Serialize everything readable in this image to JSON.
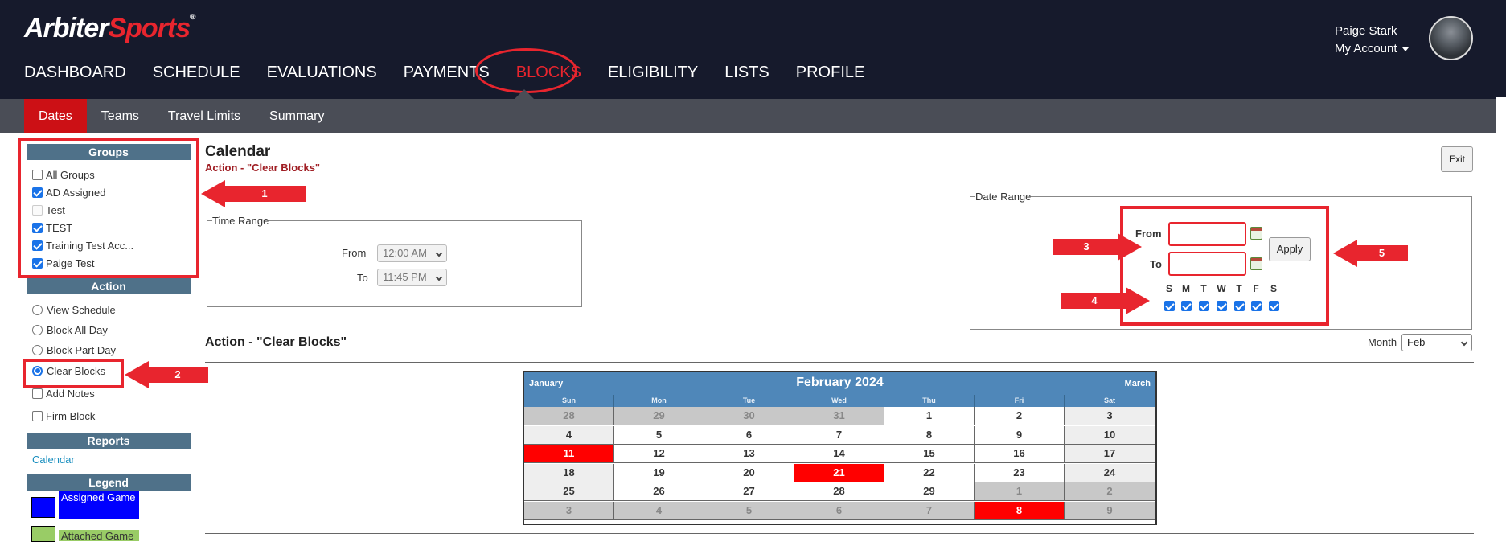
{
  "header": {
    "logo_part1": "Arbiter",
    "logo_part2": "Sports",
    "logo_tm": "®",
    "nav": [
      "DASHBOARD",
      "SCHEDULE",
      "EVALUATIONS",
      "PAYMENTS",
      "BLOCKS",
      "ELIGIBILITY",
      "LISTS",
      "PROFILE"
    ],
    "active_nav": "BLOCKS",
    "user_name": "Paige Stark",
    "account_label": "My Account"
  },
  "subnav": {
    "tabs": [
      "Dates",
      "Teams",
      "Travel Limits",
      "Summary"
    ],
    "active": "Dates"
  },
  "sidebar": {
    "groups_header": "Groups",
    "groups": [
      {
        "label": "All Groups",
        "checked": false,
        "disabled": false
      },
      {
        "label": "AD Assigned",
        "checked": true,
        "disabled": false
      },
      {
        "label": "Test",
        "checked": false,
        "disabled": true
      },
      {
        "label": "TEST",
        "checked": true,
        "disabled": false
      },
      {
        "label": "Training Test Acc...",
        "checked": true,
        "disabled": false
      },
      {
        "label": "Paige Test",
        "checked": true,
        "disabled": false
      }
    ],
    "action_header": "Action",
    "actions": [
      {
        "label": "View Schedule",
        "type": "radio",
        "checked": false
      },
      {
        "label": "Block All Day",
        "type": "radio",
        "checked": false
      },
      {
        "label": "Block Part Day",
        "type": "radio",
        "checked": false
      },
      {
        "label": "Clear Blocks",
        "type": "radio",
        "checked": true
      },
      {
        "label": "Add Notes",
        "type": "checkbox",
        "checked": false
      },
      {
        "label": "Firm Block",
        "type": "checkbox",
        "checked": false
      }
    ],
    "reports_header": "Reports",
    "reports_link": "Calendar",
    "legend_header": "Legend",
    "legend": [
      {
        "label": "Assigned Game",
        "color": "#0000ff",
        "label_bg": "#0000ff"
      },
      {
        "label": "Attached Game",
        "color": "#99cc66",
        "label_bg": "#99cc66"
      }
    ]
  },
  "main": {
    "title": "Calendar",
    "action_subtitle": "Action - \"Clear Blocks\"",
    "exit_label": "Exit",
    "time_range": {
      "legend": "Time Range",
      "from_label": "From",
      "from_value": "12:00 AM",
      "to_label": "To",
      "to_value": "11:45 PM"
    },
    "date_range": {
      "legend": "Date Range",
      "from_label": "From",
      "to_label": "To",
      "from_value": "",
      "to_value": "",
      "apply_label": "Apply",
      "days": [
        "S",
        "M",
        "T",
        "W",
        "T",
        "F",
        "S"
      ],
      "days_checked": [
        true,
        true,
        true,
        true,
        true,
        true,
        true
      ]
    },
    "action_heading": "Action - \"Clear Blocks\"",
    "month_label": "Month",
    "month_value": "Feb"
  },
  "annotations": [
    "1",
    "2",
    "3",
    "4",
    "5"
  ],
  "calendar": {
    "title": "February 2024",
    "prev": "January",
    "next": "March",
    "dow": [
      "Sun",
      "Mon",
      "Tue",
      "Wed",
      "Thu",
      "Fri",
      "Sat"
    ],
    "weeks": [
      [
        {
          "d": "28",
          "t": "other"
        },
        {
          "d": "29",
          "t": "other"
        },
        {
          "d": "30",
          "t": "other"
        },
        {
          "d": "31",
          "t": "other"
        },
        {
          "d": "1",
          "t": ""
        },
        {
          "d": "2",
          "t": ""
        },
        {
          "d": "3",
          "t": "weekend"
        }
      ],
      [
        {
          "d": "4",
          "t": "weekend"
        },
        {
          "d": "5",
          "t": ""
        },
        {
          "d": "6",
          "t": ""
        },
        {
          "d": "7",
          "t": ""
        },
        {
          "d": "8",
          "t": ""
        },
        {
          "d": "9",
          "t": ""
        },
        {
          "d": "10",
          "t": "weekend"
        }
      ],
      [
        {
          "d": "11",
          "t": "blocked"
        },
        {
          "d": "12",
          "t": ""
        },
        {
          "d": "13",
          "t": ""
        },
        {
          "d": "14",
          "t": ""
        },
        {
          "d": "15",
          "t": ""
        },
        {
          "d": "16",
          "t": ""
        },
        {
          "d": "17",
          "t": "weekend"
        }
      ],
      [
        {
          "d": "18",
          "t": "weekend"
        },
        {
          "d": "19",
          "t": ""
        },
        {
          "d": "20",
          "t": ""
        },
        {
          "d": "21",
          "t": "blocked"
        },
        {
          "d": "22",
          "t": ""
        },
        {
          "d": "23",
          "t": ""
        },
        {
          "d": "24",
          "t": "weekend"
        }
      ],
      [
        {
          "d": "25",
          "t": "weekend"
        },
        {
          "d": "26",
          "t": ""
        },
        {
          "d": "27",
          "t": ""
        },
        {
          "d": "28",
          "t": ""
        },
        {
          "d": "29",
          "t": ""
        },
        {
          "d": "1",
          "t": "other"
        },
        {
          "d": "2",
          "t": "other"
        }
      ],
      [
        {
          "d": "3",
          "t": "other"
        },
        {
          "d": "4",
          "t": "other"
        },
        {
          "d": "5",
          "t": "other"
        },
        {
          "d": "6",
          "t": "other"
        },
        {
          "d": "7",
          "t": "other"
        },
        {
          "d": "8",
          "t": "blocked"
        },
        {
          "d": "9",
          "t": "other"
        }
      ]
    ]
  }
}
